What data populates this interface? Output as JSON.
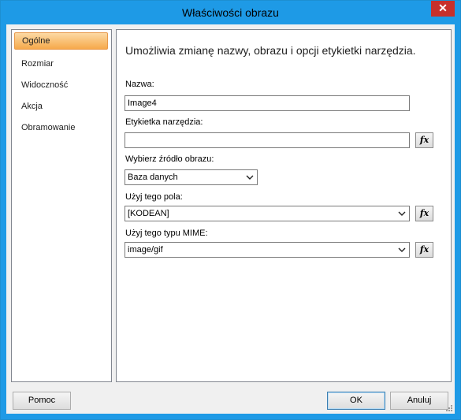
{
  "window": {
    "title": "Właściwości obrazu",
    "close_glyph": "✕"
  },
  "sidebar": {
    "items": [
      {
        "label": "Ogólne",
        "selected": true
      },
      {
        "label": "Rozmiar"
      },
      {
        "label": "Widoczność"
      },
      {
        "label": "Akcja"
      },
      {
        "label": "Obramowanie"
      }
    ]
  },
  "panel": {
    "heading": "Umożliwia zmianę nazwy, obrazu i opcji etykietki narzędzia.",
    "name": {
      "label": "Nazwa:",
      "value": "Image4"
    },
    "tooltip": {
      "label": "Etykietka narzędzia:",
      "value": ""
    },
    "source": {
      "label": "Wybierz źródło obrazu:",
      "value": "Baza danych"
    },
    "field": {
      "label": "Użyj tego pola:",
      "value": "[KODEAN]"
    },
    "mime": {
      "label": "Użyj tego typu MIME:",
      "value": "image/gif"
    },
    "fx_label": "fx"
  },
  "buttons": {
    "help": "Pomoc",
    "ok": "OK",
    "cancel": "Anuluj"
  }
}
